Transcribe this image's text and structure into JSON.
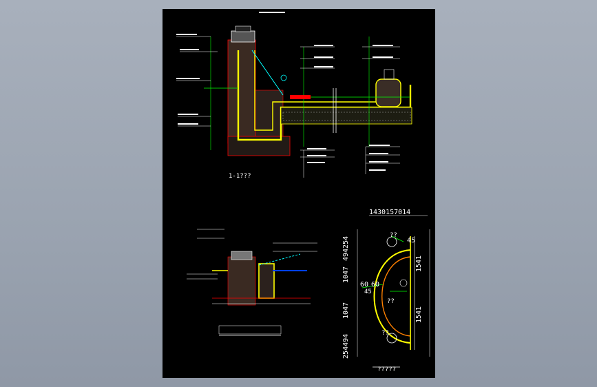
{
  "section_label": "1-1???",
  "detail_caption": "",
  "plan_caption": "?????",
  "plan_dims": {
    "top": "1430157014",
    "left_top": "494254",
    "left_mid1": "1047",
    "left_mid2": "1047",
    "left_bot": "254494",
    "right_top": "1541",
    "right_bot": "1541",
    "r_small": "45",
    "r_left": "60",
    "r_mid": "60",
    "r_inner": "45",
    "q1": "??",
    "q2": "??",
    "q3": "??"
  },
  "colors": {
    "sheet": "#000000",
    "yellow": "#ffff00",
    "green": "#00ff00",
    "red": "#ff0000",
    "cyan": "#00ffff",
    "white": "#ffffff",
    "blue": "#0040ff",
    "orange": "#ff8000",
    "magenta": "#ff00ff"
  }
}
